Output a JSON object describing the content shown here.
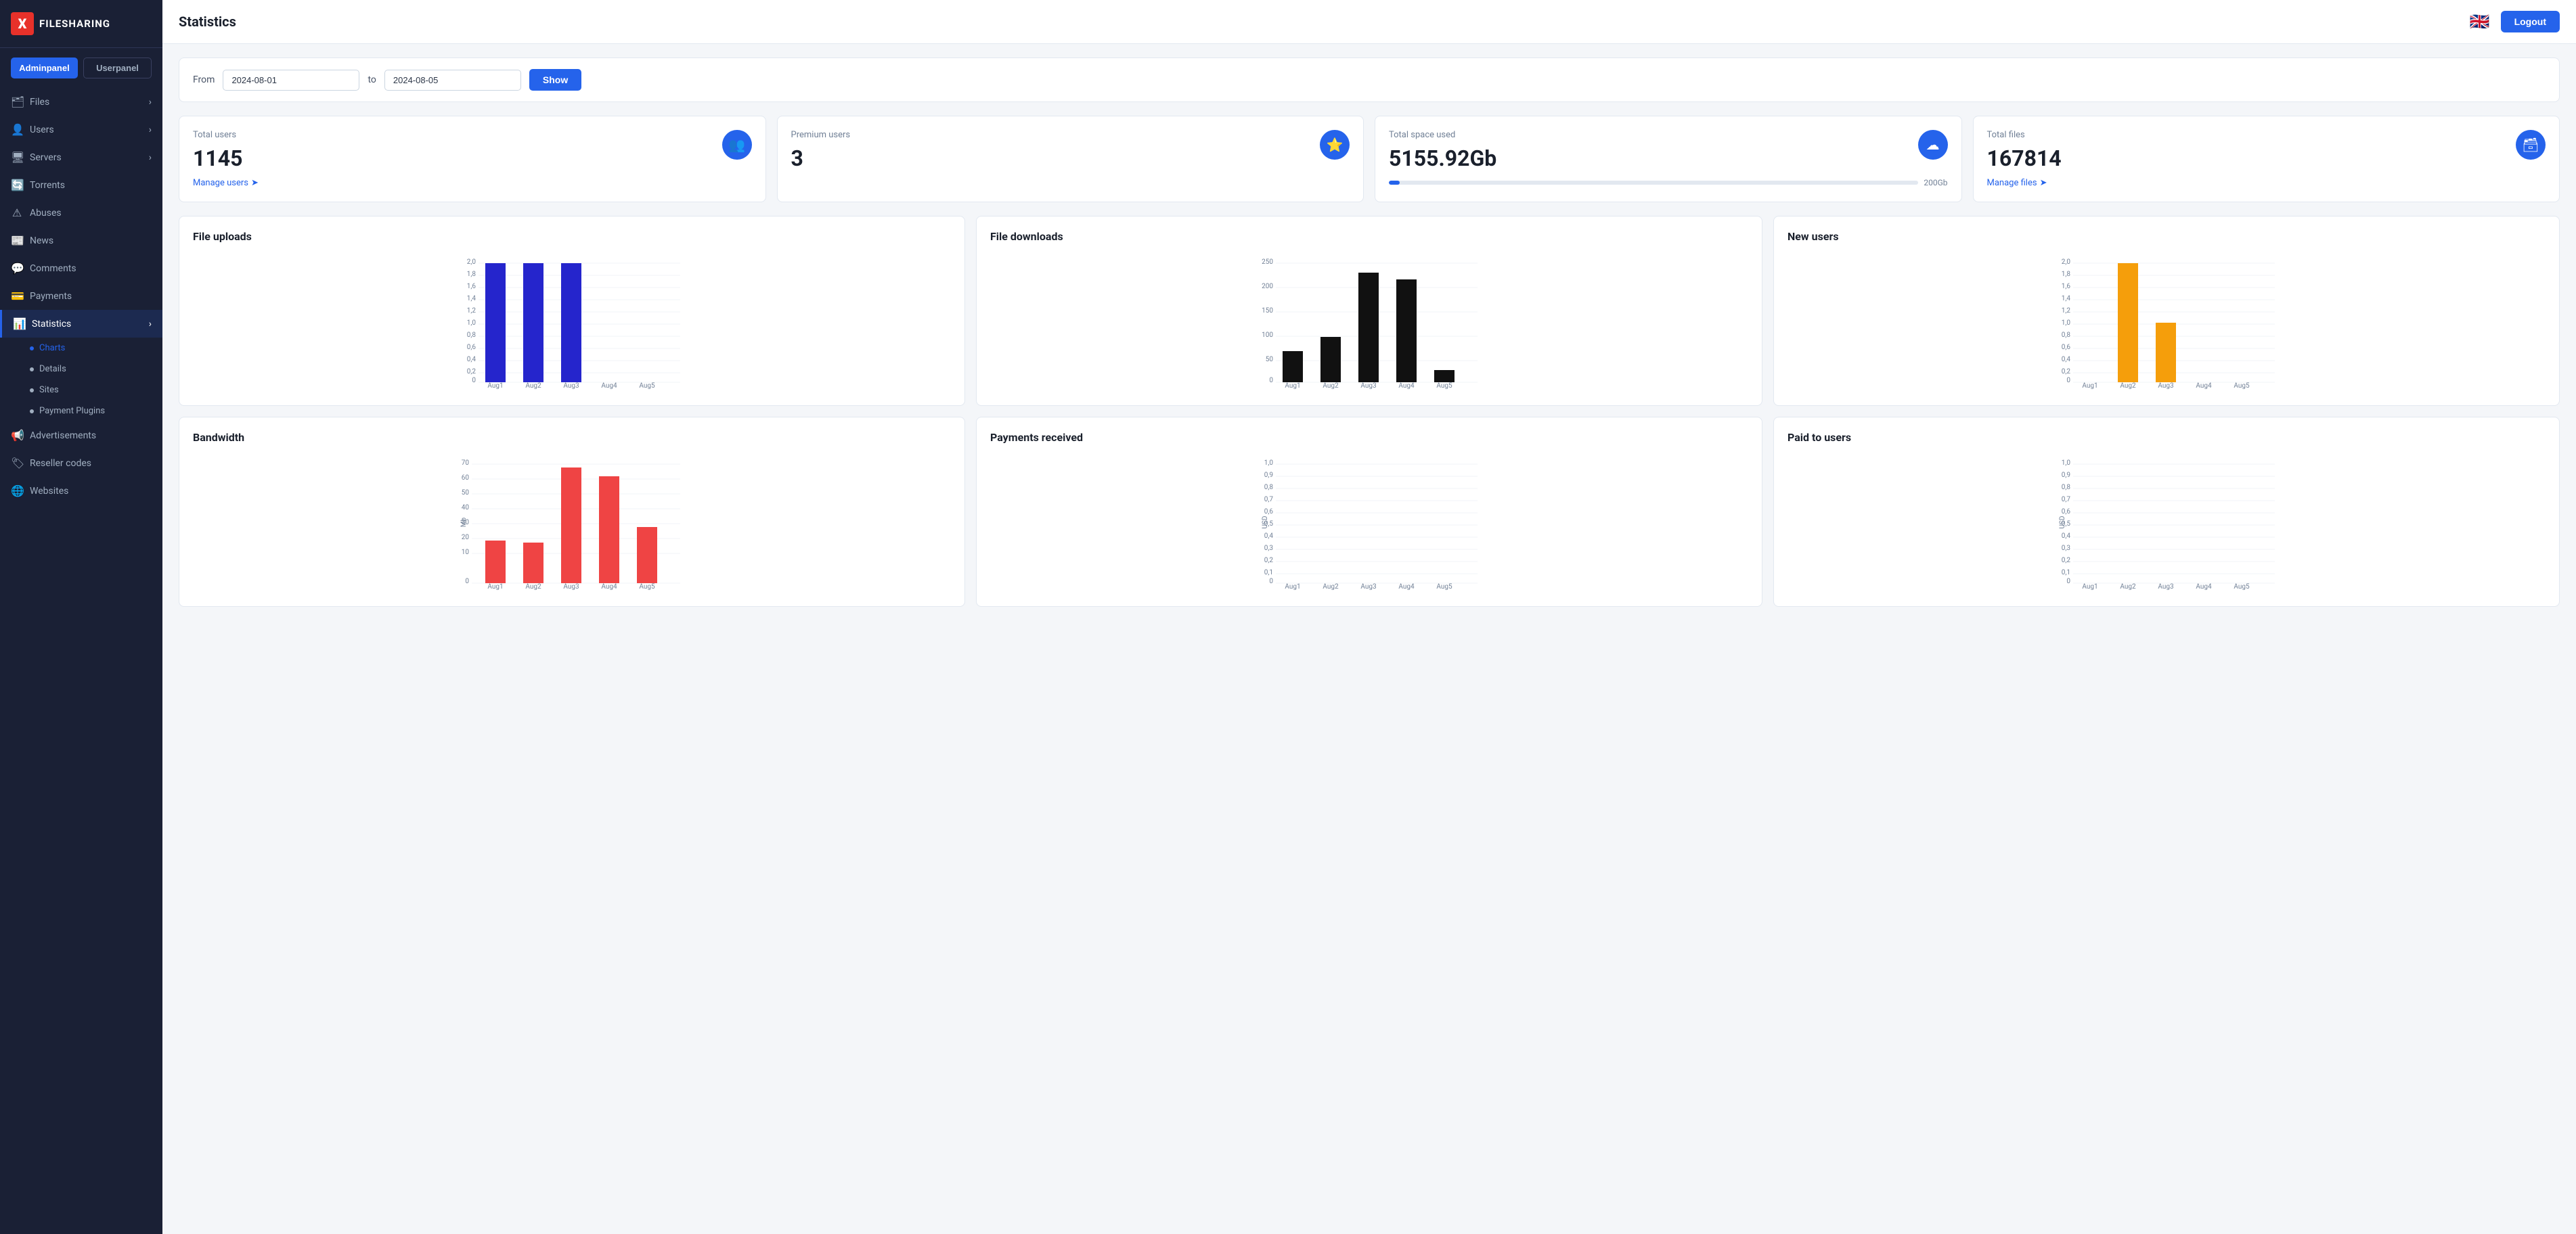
{
  "app": {
    "logo_letter": "X",
    "logo_name": "FILESHARING"
  },
  "panels": {
    "admin": "Adminpanel",
    "user": "Userpanel"
  },
  "nav": {
    "items": [
      {
        "id": "files",
        "label": "Files",
        "icon": "🗂",
        "has_arrow": true
      },
      {
        "id": "users",
        "label": "Users",
        "icon": "👤",
        "has_arrow": true
      },
      {
        "id": "servers",
        "label": "Servers",
        "icon": "🖥",
        "has_arrow": true
      },
      {
        "id": "torrents",
        "label": "Torrents",
        "icon": "🔄",
        "has_arrow": false
      },
      {
        "id": "abuses",
        "label": "Abuses",
        "icon": "⚠",
        "has_arrow": false
      },
      {
        "id": "news",
        "label": "News",
        "icon": "📰",
        "has_arrow": false
      },
      {
        "id": "comments",
        "label": "Comments",
        "icon": "💬",
        "has_arrow": false
      },
      {
        "id": "payments",
        "label": "Payments",
        "icon": "💳",
        "has_arrow": false
      },
      {
        "id": "statistics",
        "label": "Statistics",
        "icon": "📊",
        "has_arrow": true,
        "active": true
      },
      {
        "id": "advertisements",
        "label": "Advertisements",
        "icon": "📢",
        "has_arrow": false
      },
      {
        "id": "reseller_codes",
        "label": "Reseller codes",
        "icon": "🏷",
        "has_arrow": false
      },
      {
        "id": "websites",
        "label": "Websites",
        "icon": "🌐",
        "has_arrow": false
      }
    ],
    "statistics_sub": [
      {
        "id": "charts",
        "label": "Charts",
        "active": true
      },
      {
        "id": "details",
        "label": "Details"
      },
      {
        "id": "sites",
        "label": "Sites"
      },
      {
        "id": "payment_plugins",
        "label": "Payment Plugins"
      }
    ]
  },
  "topbar": {
    "title": "Statistics",
    "flag": "🇬🇧",
    "logout": "Logout"
  },
  "filter": {
    "from_label": "From",
    "from_value": "2024-08-01",
    "to_label": "to",
    "to_value": "2024-08-05",
    "show_label": "Show"
  },
  "stat_cards": [
    {
      "id": "total_users",
      "title": "Total users",
      "value": "1145",
      "link": "Manage users",
      "icon": "👥",
      "icon_class": "icon-blue"
    },
    {
      "id": "premium_users",
      "title": "Premium users",
      "value": "3",
      "icon": "⭐",
      "icon_class": "icon-blue"
    },
    {
      "id": "total_space",
      "title": "Total space used",
      "value": "5155.92Gb",
      "progress": 2,
      "progress_max": "200Gb",
      "icon": "☁",
      "icon_class": "icon-blue"
    },
    {
      "id": "total_files",
      "title": "Total files",
      "value": "167814",
      "link": "Manage files",
      "icon": "🗃",
      "icon_class": "icon-blue"
    }
  ],
  "charts": {
    "file_uploads": {
      "title": "File uploads",
      "color": "#2525cc",
      "labels": [
        "Aug1",
        "Aug2",
        "Aug3",
        "Aug4",
        "Aug5"
      ],
      "values": [
        2.0,
        2.0,
        2.0,
        0,
        0
      ],
      "ymax": 2.0,
      "yticks": [
        0,
        0.2,
        0.4,
        0.6,
        0.8,
        1.0,
        1.2,
        1.4,
        1.6,
        1.8,
        2.0
      ]
    },
    "file_downloads": {
      "title": "File downloads",
      "color": "#111111",
      "labels": [
        "Aug1",
        "Aug2",
        "Aug3",
        "Aug4",
        "Aug5"
      ],
      "values": [
        65,
        95,
        230,
        215,
        25
      ],
      "ymax": 250,
      "yticks": [
        0,
        50,
        100,
        150,
        200,
        250
      ]
    },
    "new_users": {
      "title": "New users",
      "color": "#f59e0b",
      "labels": [
        "Aug1",
        "Aug2",
        "Aug3",
        "Aug4",
        "Aug5"
      ],
      "values": [
        0,
        2.0,
        1.0,
        0,
        0
      ],
      "ymax": 2.0,
      "yticks": [
        0,
        0.2,
        0.4,
        0.6,
        0.8,
        1.0,
        1.2,
        1.4,
        1.6,
        1.8,
        2.0
      ]
    },
    "bandwidth": {
      "title": "Bandwidth",
      "color": "#ef4444",
      "ylabel": "Mb",
      "labels": [
        "Aug1",
        "Aug2",
        "Aug3",
        "Aug4",
        "Aug5"
      ],
      "values": [
        25,
        24,
        68,
        63,
        33
      ],
      "ymax": 70,
      "yticks": [
        0,
        10,
        20,
        30,
        40,
        50,
        60,
        70
      ]
    },
    "payments_received": {
      "title": "Payments received",
      "color": "#111111",
      "ylabel": "USD",
      "labels": [
        "Aug1",
        "Aug2",
        "Aug3",
        "Aug4",
        "Aug5"
      ],
      "values": [
        0,
        0,
        0,
        0,
        0
      ],
      "ymax": 1.0,
      "yticks": [
        0,
        0.1,
        0.2,
        0.3,
        0.4,
        0.5,
        0.6,
        0.7,
        0.8,
        0.9,
        1.0
      ]
    },
    "paid_to_users": {
      "title": "Paid to users",
      "color": "#111111",
      "ylabel": "USD",
      "labels": [
        "Aug1",
        "Aug2",
        "Aug3",
        "Aug4",
        "Aug5"
      ],
      "values": [
        0,
        0,
        0,
        0,
        0
      ],
      "ymax": 1.0,
      "yticks": [
        0,
        0.1,
        0.2,
        0.3,
        0.4,
        0.5,
        0.6,
        0.7,
        0.8,
        0.9,
        1.0
      ]
    }
  }
}
